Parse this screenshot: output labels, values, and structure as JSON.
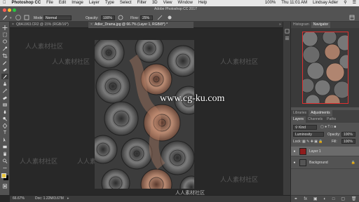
{
  "menubar": {
    "apple_icon": "apple-icon",
    "app_name": "Photoshop CC",
    "items": [
      "File",
      "Edit",
      "Image",
      "Layer",
      "Type",
      "Select",
      "Filter",
      "3D",
      "View",
      "Window",
      "Help"
    ],
    "battery": "100%",
    "clock": "Thu 11:01 AM",
    "user": "Lindsay Adler"
  },
  "window": {
    "title": "Adobe Photoshop CC 2017"
  },
  "options": {
    "mode_label": "Mode:",
    "mode_value": "Normal",
    "opacity_label": "Opacity:",
    "opacity_value": "100%",
    "flow_label": "Flow:",
    "flow_value": "25%"
  },
  "tabs": [
    {
      "label": "Q8A1963.CR2 @ 15% (RGB/16*)",
      "active": false
    },
    {
      "label": "Adler_Drama.jpg @ 66.7% (Layer 1, RGB/8*) *",
      "active": true
    }
  ],
  "canvas": {
    "watermark": "www.cg-ku.com",
    "faint_marks": [
      "人人素材社区",
      "人人素材社区",
      "人人素材社区",
      "人人素材社区",
      "人人素材社区",
      "人人素材社区"
    ],
    "logo_text": "人人素材社区"
  },
  "status": {
    "zoom": "66.67%",
    "doc": "Doc: 1.22M/3.67M"
  },
  "panels": {
    "top_tabs": [
      "Histogram",
      "Navigator"
    ],
    "mid_tabs": [
      "Libraries",
      "Adjustments"
    ],
    "layer_tabs": [
      "Layers",
      "Channels",
      "Paths"
    ],
    "kind_label": "Kind",
    "blend_mode": "Luminosity",
    "opacity_label": "Opacity:",
    "opacity_value": "100%",
    "lock_label": "Lock:",
    "fill_label": "Fill:",
    "fill_value": "100%",
    "layers": [
      {
        "name": "Layer 1",
        "selected": true
      },
      {
        "name": "Background",
        "selected": false
      }
    ]
  },
  "colors": {
    "foreground": "#e8c53a",
    "background": "#000000",
    "accent": "#c0392b"
  }
}
